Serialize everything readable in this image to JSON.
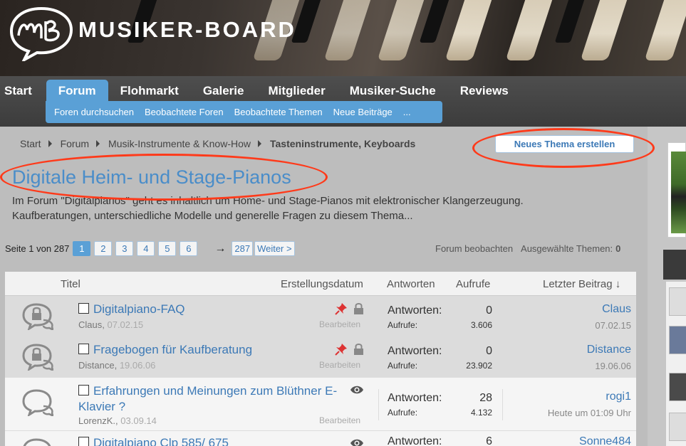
{
  "header": {
    "logo_text": "MUSIKER-BOARD",
    "logo_icon": "mb-speech-bubble-logo"
  },
  "nav": {
    "tabs": [
      {
        "label": "Start",
        "active": false
      },
      {
        "label": "Forum",
        "active": true
      },
      {
        "label": "Flohmarkt",
        "active": false
      },
      {
        "label": "Galerie",
        "active": false
      },
      {
        "label": "Mitglieder",
        "active": false
      },
      {
        "label": "Musiker-Suche",
        "active": false
      },
      {
        "label": "Reviews",
        "active": false
      }
    ],
    "subnav": [
      "Foren durchsuchen",
      "Beobachtete Foren",
      "Beobachtete Themen",
      "Neue Beiträge",
      "..."
    ]
  },
  "breadcrumb": {
    "items": [
      "Start",
      "Forum",
      "Musik-Instrumente & Know-How"
    ],
    "current": "Tasteninstrumente, Keyboards"
  },
  "new_thread_button": "Neues Thema erstellen",
  "forum": {
    "title": "Digitale Heim- und Stage-Pianos",
    "description": "Im Forum \"Digitalpianos\" geht es inhaltlich um Home- und Stage-Pianos mit elektronischer Klangerzeugung. Kaufberatungen, unterschiedliche Modelle und generelle Fragen zu diesem Thema..."
  },
  "pagination": {
    "label": "Seite 1 von 287",
    "pages": [
      "1",
      "2",
      "3",
      "4",
      "5",
      "6"
    ],
    "active_page": "1",
    "arrow": "→",
    "last": "287",
    "next": "Weiter >"
  },
  "controls": {
    "watch_forum": "Forum beobachten",
    "selected_label": "Ausgewählte Themen:",
    "selected_count": "0"
  },
  "table": {
    "headers": {
      "title": "Titel",
      "created": "Erstellungsdatum",
      "replies": "Antworten",
      "views": "Aufrufe",
      "last_post": "Letzter Beitrag ↓"
    },
    "rows": [
      {
        "title": "Digitalpiano-FAQ",
        "author": "Claus",
        "date": "07.02.15",
        "edit": "Bearbeiten",
        "replies_label": "Antworten:",
        "replies": "0",
        "views_label": "Aufrufe:",
        "views": "3.606",
        "last_user": "Claus",
        "last_date": "07.02.15",
        "sticky": true,
        "locked": true
      },
      {
        "title": "Fragebogen für Kaufberatung",
        "author": "Distance",
        "date": "19.06.06",
        "edit": "Bearbeiten",
        "replies_label": "Antworten:",
        "replies": "0",
        "views_label": "Aufrufe:",
        "views": "23.902",
        "last_user": "Distance",
        "last_date": "19.06.06",
        "sticky": true,
        "locked": true
      },
      {
        "title": "Erfahrungen und Meinungen zum Blüthner E-Klavier ?",
        "author": "LorenzK.",
        "date": "03.09.14",
        "edit": "Bearbeiten",
        "replies_label": "Antworten:",
        "replies": "28",
        "views_label": "Aufrufe:",
        "views": "4.132",
        "last_user": "rogi1",
        "last_date": "Heute um 01:09 Uhr",
        "sticky": false,
        "locked": false
      },
      {
        "title": "Digitalpiano Clp 585/ 675",
        "author": "",
        "date": "",
        "edit": "",
        "replies_label": "Antworten:",
        "replies": "6",
        "views_label": "",
        "views": "",
        "last_user": "Sonne484",
        "last_date": "",
        "sticky": false,
        "locked": false
      }
    ]
  },
  "colors": {
    "accent": "#5aa0d6",
    "link": "#3c79b6",
    "annotation": "#ff3a1a"
  }
}
